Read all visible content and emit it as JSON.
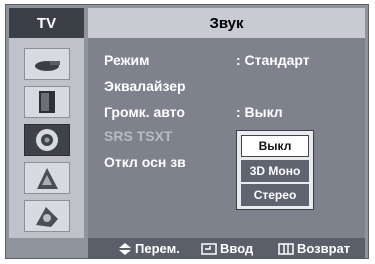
{
  "header": {
    "tv_label": "TV",
    "title": "Звук"
  },
  "sidebar": {
    "items": [
      {
        "icon": "antenna-icon"
      },
      {
        "icon": "display-icon"
      },
      {
        "icon": "speaker-icon"
      },
      {
        "icon": "channel-icon"
      },
      {
        "icon": "setup-icon"
      }
    ],
    "active_index": 2
  },
  "menu": {
    "items": [
      {
        "label": "Режим",
        "value": ":  Стандарт"
      },
      {
        "label": "Эквалайзер",
        "value": ""
      },
      {
        "label": "Громк. авто",
        "value": ":  Выкл"
      },
      {
        "label": "SRS TSXT",
        "value": ":"
      },
      {
        "label": "Откл осн зв",
        "value": ":"
      }
    ],
    "dim_index": 3
  },
  "popup": {
    "options": [
      "Выкл",
      "3D Моно",
      "Стерео"
    ],
    "selected_index": 0
  },
  "footer": {
    "move": "Перем.",
    "enter": "Ввод",
    "return": "Возврат"
  },
  "colors": {
    "header_dark": "#3b3f46",
    "panel": "#7d828c",
    "sidebar": "#bfc3c9"
  }
}
